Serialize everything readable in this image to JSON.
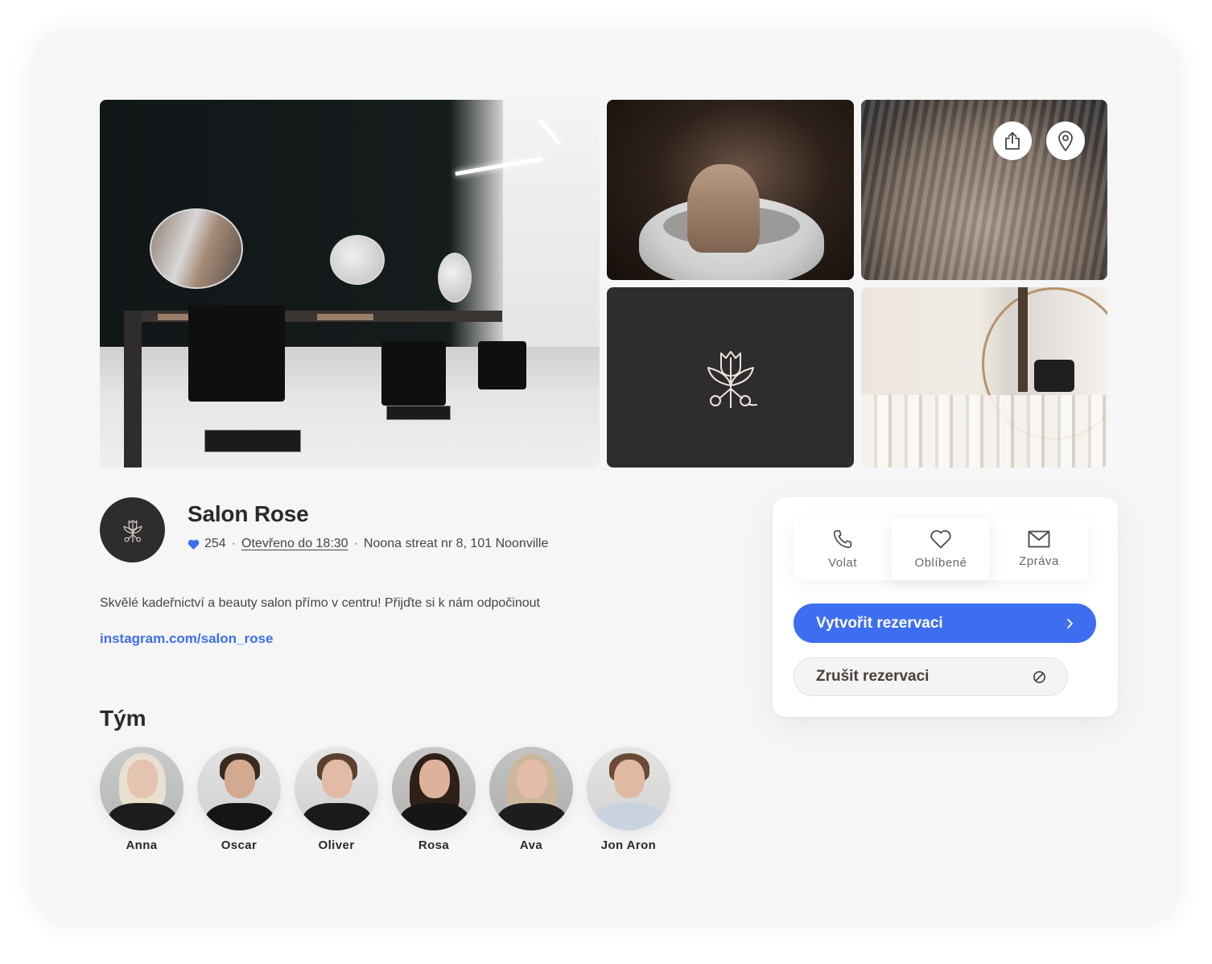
{
  "gallery": {
    "photos": [
      {
        "name": "salon-interior-photo",
        "description": "Salon interior with mirrors and chairs"
      },
      {
        "name": "hair-washing-photo",
        "description": "Hair washing at basin"
      },
      {
        "name": "hair-waves-photo",
        "description": "Wavy blonde hair"
      },
      {
        "name": "logo-tile",
        "description": "Salon Rose logo"
      },
      {
        "name": "products-photo",
        "description": "Hair products and salon chairs"
      }
    ],
    "share_icon": "share-icon",
    "location_icon": "map-pin-icon"
  },
  "business": {
    "name": "Salon Rose",
    "likes": "254",
    "separator": "·",
    "open_status": "Otevřeno do 18:30",
    "address": "Noona streat nr 8, 101 Noonville",
    "description": "Skvělé kadeřnictví a beauty salon přímo v centru! Přijďte si k nám odpočinout",
    "instagram": "instagram.com/salon_rose"
  },
  "team": {
    "title": "Tým",
    "members": [
      {
        "name": "Anna"
      },
      {
        "name": "Oscar"
      },
      {
        "name": "Oliver"
      },
      {
        "name": "Rosa"
      },
      {
        "name": "Ava"
      },
      {
        "name": "Jon Aron"
      }
    ]
  },
  "booking": {
    "actions": [
      {
        "label": "Volat",
        "icon": "phone-icon"
      },
      {
        "label": "Oblíbené",
        "icon": "heart-icon"
      },
      {
        "label": "Zpráva",
        "icon": "mail-icon"
      }
    ],
    "create_label": "Vytvořit rezervaci",
    "cancel_label": "Zrušit rezervaci"
  },
  "colors": {
    "accent": "#3e6ef0",
    "text_dark": "#2b2a2a",
    "logo_bg": "#2e2c2d",
    "page_bg": "#f6f6f6"
  }
}
